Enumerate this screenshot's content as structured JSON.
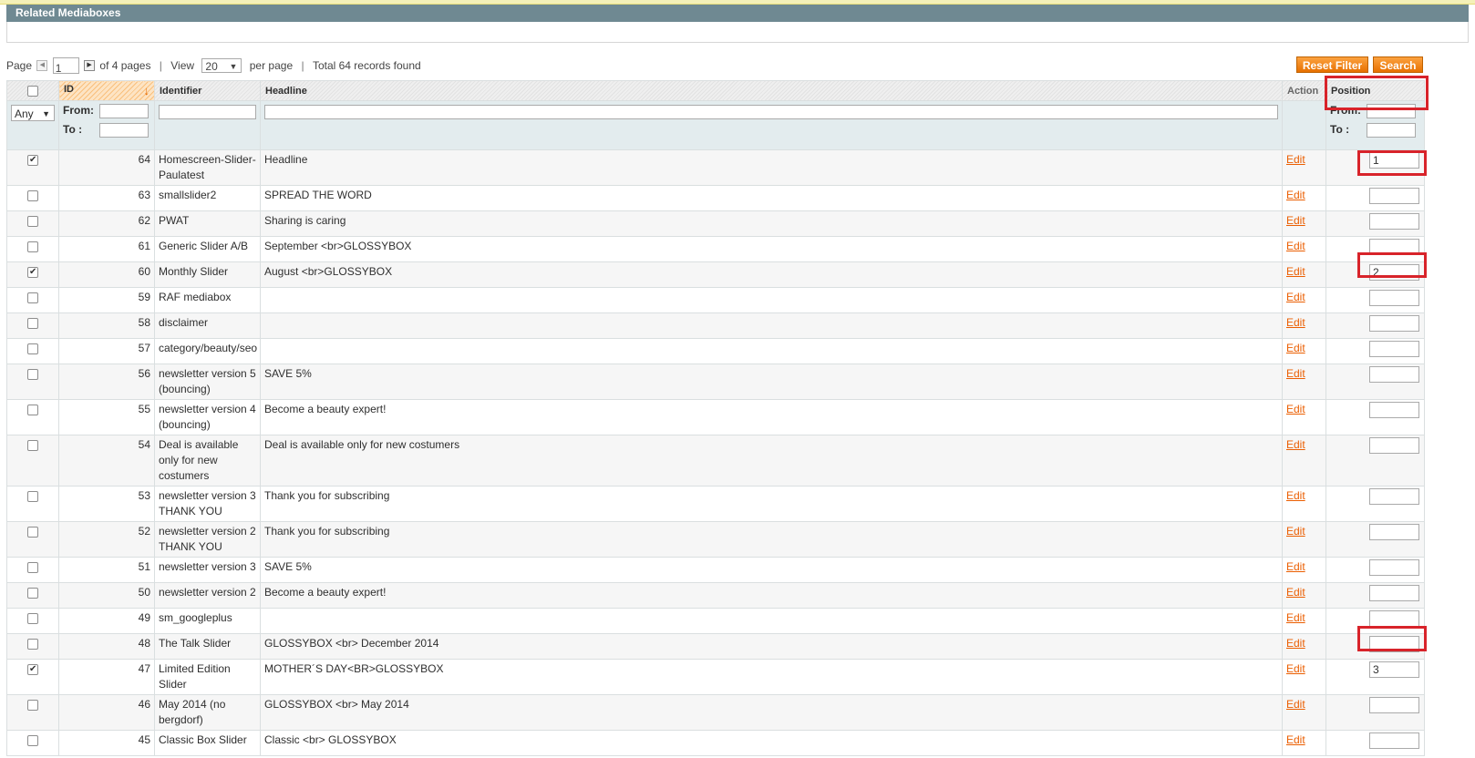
{
  "section": {
    "title": "Related Mediaboxes"
  },
  "pager": {
    "page_label": "Page",
    "page_value": "1",
    "of_pages": "of 4 pages",
    "view_label": "View",
    "per_page_value": "20",
    "per_page_suffix": "per page",
    "total": "Total 64 records found"
  },
  "buttons": {
    "reset_filter": "Reset Filter",
    "search": "Search"
  },
  "columns": {
    "id": "ID",
    "identifier": "Identifier",
    "headline": "Headline",
    "action": "Action",
    "position": "Position"
  },
  "filters": {
    "any": "Any",
    "from": "From:",
    "to": "To :"
  },
  "edit_label": "Edit",
  "rows": [
    {
      "id": "64",
      "identifier": "Homescreen-Slider-Paulatest",
      "headline": "Headline",
      "checked": true,
      "position": "1"
    },
    {
      "id": "63",
      "identifier": "smallslider2",
      "headline": "SPREAD THE WORD",
      "checked": false,
      "position": ""
    },
    {
      "id": "62",
      "identifier": "PWAT",
      "headline": "Sharing is caring",
      "checked": false,
      "position": ""
    },
    {
      "id": "61",
      "identifier": "Generic Slider A/B",
      "headline": "September <br>GLOSSYBOX",
      "checked": false,
      "position": ""
    },
    {
      "id": "60",
      "identifier": "Monthly Slider",
      "headline": "August <br>GLOSSYBOX",
      "checked": true,
      "position": "2"
    },
    {
      "id": "59",
      "identifier": "RAF mediabox",
      "headline": "",
      "checked": false,
      "position": ""
    },
    {
      "id": "58",
      "identifier": "disclaimer",
      "headline": "",
      "checked": false,
      "position": ""
    },
    {
      "id": "57",
      "identifier": "category/beauty/seo",
      "headline": "",
      "checked": false,
      "position": ""
    },
    {
      "id": "56",
      "identifier": "newsletter version 5 (bouncing)",
      "headline": "SAVE 5%",
      "checked": false,
      "position": ""
    },
    {
      "id": "55",
      "identifier": "newsletter version 4 (bouncing)",
      "headline": "Become a beauty expert!",
      "checked": false,
      "position": ""
    },
    {
      "id": "54",
      "identifier": "Deal is available only for new costumers",
      "headline": "Deal is available only for new costumers",
      "checked": false,
      "position": ""
    },
    {
      "id": "53",
      "identifier": "newsletter version 3 THANK YOU",
      "headline": "Thank you for subscribing",
      "checked": false,
      "position": ""
    },
    {
      "id": "52",
      "identifier": "newsletter version 2 THANK YOU",
      "headline": "Thank you for subscribing",
      "checked": false,
      "position": ""
    },
    {
      "id": "51",
      "identifier": "newsletter version 3",
      "headline": "SAVE 5%",
      "checked": false,
      "position": ""
    },
    {
      "id": "50",
      "identifier": "newsletter version 2",
      "headline": "Become a beauty expert!",
      "checked": false,
      "position": ""
    },
    {
      "id": "49",
      "identifier": "sm_googleplus",
      "headline": "",
      "checked": false,
      "position": ""
    },
    {
      "id": "48",
      "identifier": "The Talk Slider",
      "headline": "GLOSSYBOX <br> December 2014",
      "checked": false,
      "position": ""
    },
    {
      "id": "47",
      "identifier": "Limited Edition Slider",
      "headline": "MOTHER´S DAY<BR>GLOSSYBOX",
      "checked": true,
      "position": "3"
    },
    {
      "id": "46",
      "identifier": "May 2014 (no bergdorf)",
      "headline": "GLOSSYBOX <br> May 2014",
      "checked": false,
      "position": ""
    },
    {
      "id": "45",
      "identifier": "Classic Box Slider",
      "headline": "Classic <br> GLOSSYBOX",
      "checked": false,
      "position": ""
    }
  ]
}
